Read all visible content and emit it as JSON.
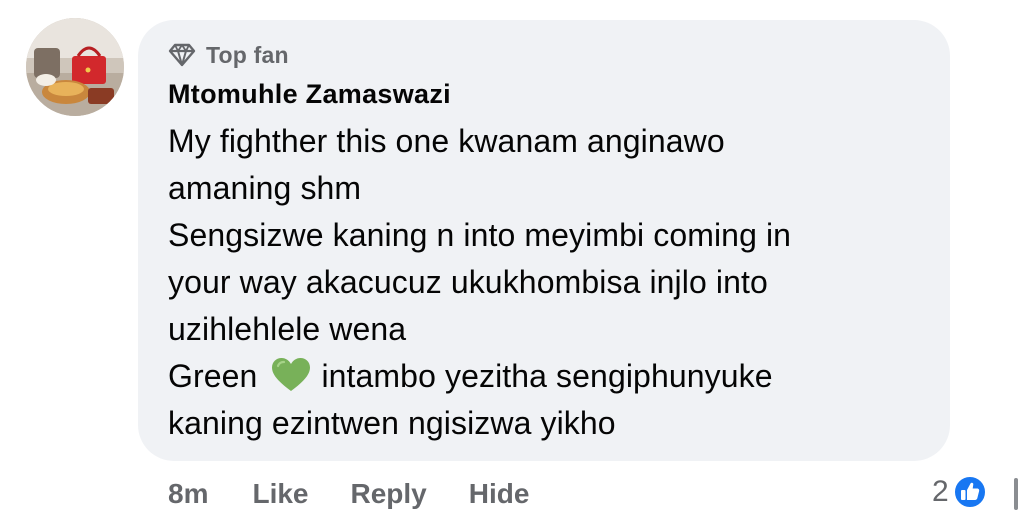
{
  "comment": {
    "badge_label": "Top fan",
    "badge_icon": "diamond-icon",
    "author": "Mtomuhle Zamaswazi",
    "lines": [
      "My fighther this one kwanam anginawo",
      "amaning shm",
      "Sengsizwe kaning n into meyimbi coming in",
      "your way akacucuz ukukhombisa injlo into",
      "uzihlehlele wena"
    ],
    "line6_before_emoji": "Green",
    "line6_emoji": "green-heart",
    "line6_after_emoji": "intambo yezitha sengiphunyuke",
    "line7": "kaning ezintwen ngisizwa yikho"
  },
  "actions": {
    "timestamp": "8m",
    "like": "Like",
    "reply": "Reply",
    "hide": "Hide"
  },
  "reactions": {
    "count": "2",
    "icon": "like-reaction-icon"
  },
  "colors": {
    "bubble": "#f0f2f5",
    "secondary_text": "#65676b",
    "like_blue": "#1877f2",
    "heart_green": "#78b159"
  }
}
